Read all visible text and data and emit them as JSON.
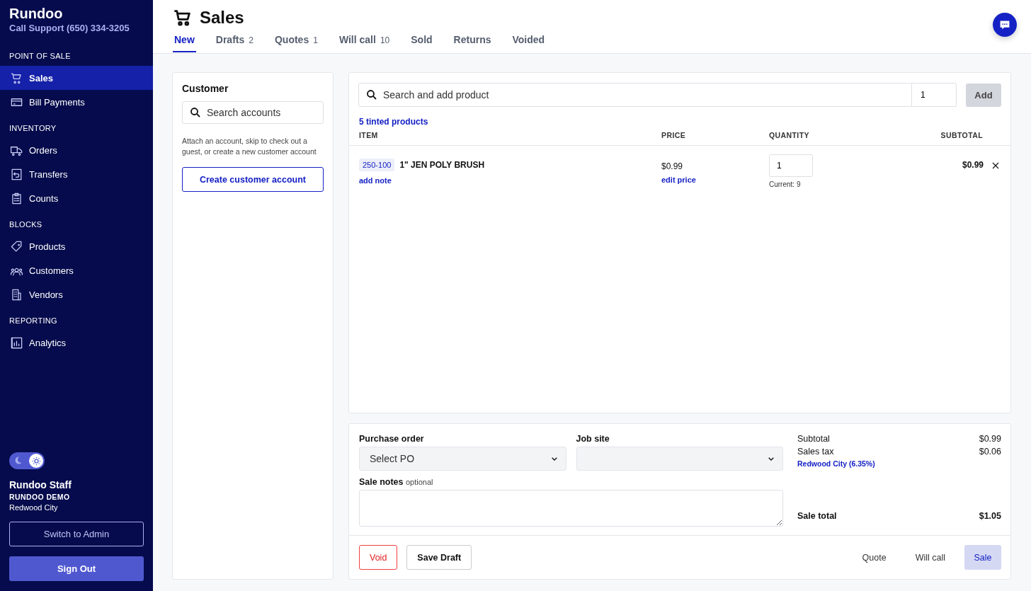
{
  "brand": {
    "name": "Rundoo",
    "support": "Call Support (650) 334-3205"
  },
  "sidebar": {
    "sections": [
      {
        "heading": "POINT OF SALE",
        "items": [
          {
            "label": "Sales",
            "selected": true
          },
          {
            "label": "Bill Payments",
            "selected": false
          }
        ]
      },
      {
        "heading": "INVENTORY",
        "items": [
          {
            "label": "Orders",
            "selected": false
          },
          {
            "label": "Transfers",
            "selected": false
          },
          {
            "label": "Counts",
            "selected": false
          }
        ]
      },
      {
        "heading": "BLOCKS",
        "items": [
          {
            "label": "Products",
            "selected": false
          },
          {
            "label": "Customers",
            "selected": false
          },
          {
            "label": "Vendors",
            "selected": false
          }
        ]
      },
      {
        "heading": "REPORTING",
        "items": [
          {
            "label": "Analytics",
            "selected": false
          }
        ]
      }
    ],
    "theme_toggle": {
      "light_mode": true
    },
    "user": {
      "name": "Rundoo Staff",
      "company": "RUNDOO DEMO",
      "location": "Redwood City"
    },
    "buttons": [
      {
        "label": "Switch to Admin",
        "kind": "outline"
      },
      {
        "label": "Sign Out",
        "kind": "filled"
      }
    ]
  },
  "page": {
    "title": "Sales"
  },
  "tabs": [
    {
      "label": "New",
      "selected": true
    },
    {
      "label": "Drafts",
      "count": "2",
      "selected": false
    },
    {
      "label": "Quotes",
      "count": "1",
      "selected": false
    },
    {
      "label": "Will call",
      "count": "10",
      "selected": false
    },
    {
      "label": "Sold",
      "selected": false
    },
    {
      "label": "Returns",
      "selected": false
    },
    {
      "label": "Voided",
      "selected": false
    }
  ],
  "customer": {
    "title": "Customer",
    "search_placeholder": "Search accounts",
    "help": "Attach an account, skip to check out a guest, or create a new customer account",
    "button": "Create customer account"
  },
  "product_search": {
    "placeholder": "Search and add product",
    "quantity": "1",
    "button": "Add"
  },
  "tinted_link": "5 tinted products",
  "table": {
    "columns": [
      "ITEM",
      "PRICE",
      "QUANTITY",
      "SUBTOTAL"
    ],
    "rows": [
      {
        "sku": "250-100",
        "name": "1\" JEN POLY BRUSH",
        "note_link": "add note",
        "price": "$0.99",
        "price_link": "edit price",
        "quantity": "1",
        "current": "Current: 9",
        "subtotal": "$0.99"
      }
    ]
  },
  "order": {
    "purchase_order_label": "Purchase order",
    "purchase_order_value": "Select PO",
    "job_site_label": "Job site",
    "notes_label": "Sale notes",
    "notes_hint": "optional"
  },
  "totals": {
    "subtotal_label": "Subtotal",
    "subtotal": "$0.99",
    "tax_label": "Sales tax",
    "tax": "$0.06",
    "tax_location": "Redwood City (6.35%)",
    "total_label": "Sale total",
    "total": "$1.05"
  },
  "actions": [
    {
      "label": "Void",
      "kind": "danger"
    },
    {
      "label": "Save Draft",
      "kind": "outline"
    },
    {
      "label": "Quote",
      "kind": "text"
    },
    {
      "label": "Will call",
      "kind": "text"
    },
    {
      "label": "Sale",
      "kind": "primary"
    }
  ]
}
